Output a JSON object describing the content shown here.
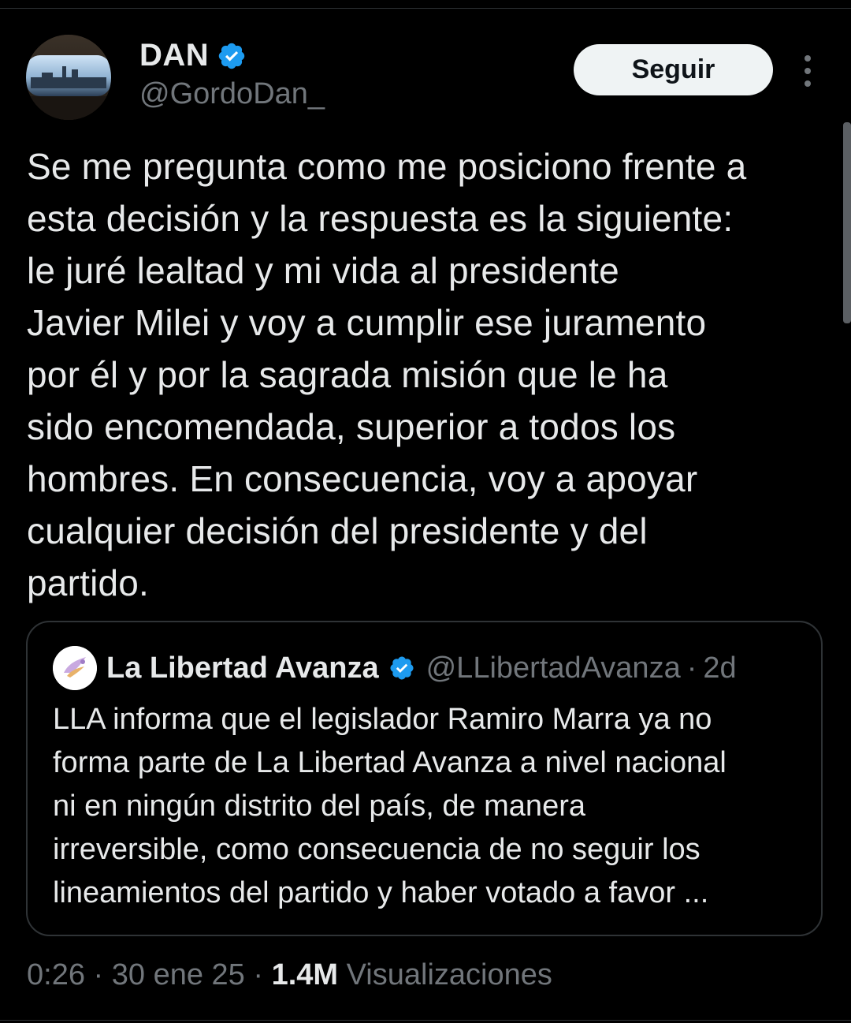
{
  "author": {
    "name": "DAN",
    "handle": "@GordoDan_",
    "avatar": "profile-photo",
    "verified_icon": "verified-badge-icon"
  },
  "actions": {
    "follow_label": "Seguir",
    "more_icon": "more-vertical-icon"
  },
  "tweet": {
    "text": "Se me pregunta como me posiciono frente a\nesta decisión y la respuesta es la siguiente:\nle juré lealtad y mi vida al presidente\nJavier Milei y voy a cumplir ese juramento\npor él y por la sagrada misión que le ha\nsido encomendada, superior a todos los\nhombres. En consecuencia, voy a apoyar\ncualquier decisión del presidente y del\npartido."
  },
  "quoted_tweet": {
    "name": "La Libertad Avanza",
    "handle": "@LLibertadAvanza",
    "separator": "·",
    "time": "2d",
    "text": "LLA informa que el legislador Ramiro Marra ya no\nforma parte de La Libertad Avanza a nivel nacional\nni en ningún distrito del país, de manera\nirreversible, como consecuencia de no seguir los\nlineamientos del partido y haber votado a favor ..."
  },
  "meta": {
    "time": "0:26",
    "sep1": " · ",
    "date": "30 ene 25",
    "sep2": " · ",
    "views": "1.4M",
    "views_label": " Visualizaciones"
  },
  "colors": {
    "background": "#000000",
    "text_primary": "#e7e9ea",
    "text_secondary": "#71767b",
    "verified": "#1d9bf0",
    "border": "#2f3336"
  }
}
